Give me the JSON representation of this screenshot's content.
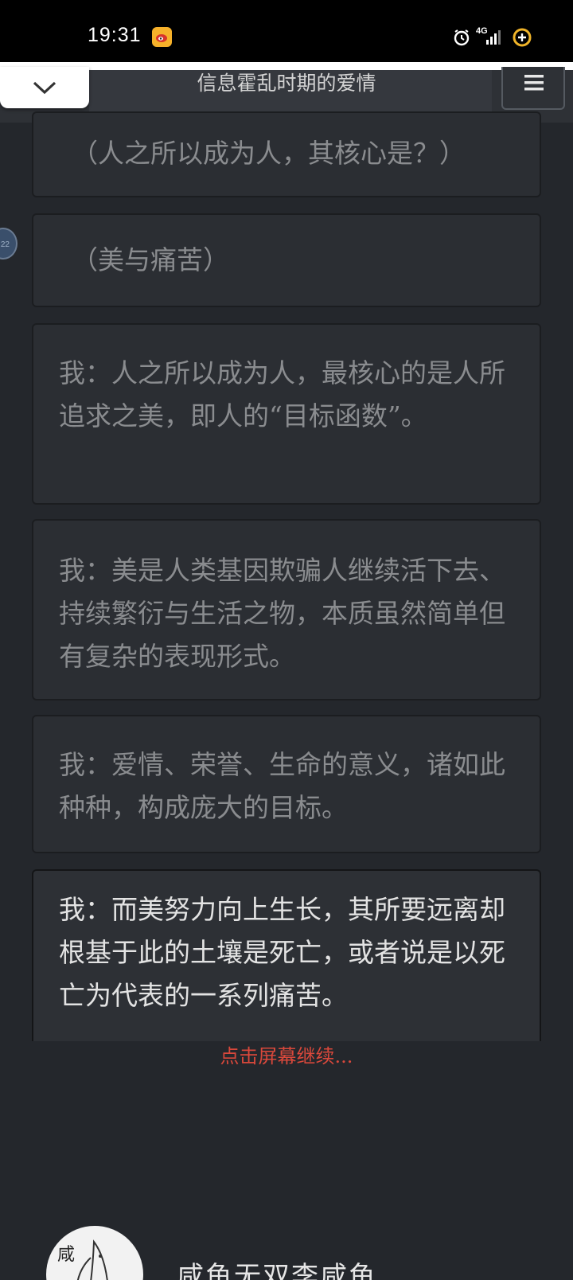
{
  "status_bar": {
    "time": "19:31",
    "network": "4G",
    "icons": [
      "weibo-icon",
      "alarm-icon",
      "signal-icon",
      "battery-saver-icon"
    ]
  },
  "nav": {
    "title": "信息霍乱时期的爱情",
    "collapse_icon": "chevron-down-icon",
    "menu_icon": "hamburger-menu-icon"
  },
  "side_bubble": {
    "label": "22"
  },
  "messages": [
    {
      "text": "（人之所以成为人，其核心是？）"
    },
    {
      "text": "（美与痛苦）"
    },
    {
      "text": "我：人之所以成为人，最核心的是人所追求之美，即人的“目标函数”。"
    },
    {
      "text": "我：美是人类基因欺骗人继续活下去、持续繁衍与生活之物，本质虽然简单但有复杂的表现形式。"
    },
    {
      "text": "我：爱情、荣誉、生命的意义，诸如此种种，构成庞大的目标。"
    },
    {
      "text": "我：而美努力向上生长，其所要远离却根基于此的土壤是死亡，或者说是以死亡为代表的一系列痛苦。"
    }
  ],
  "continue_hint": "点击屏幕继续...",
  "author": {
    "avatar_char": "咸",
    "name": "咸鱼无双李咸鱼"
  },
  "colors": {
    "background": "#24272c",
    "card": "#2b2e33",
    "read_text": "#8a8c8f",
    "current_text": "#e3e3e3",
    "hint": "#d9483b"
  }
}
